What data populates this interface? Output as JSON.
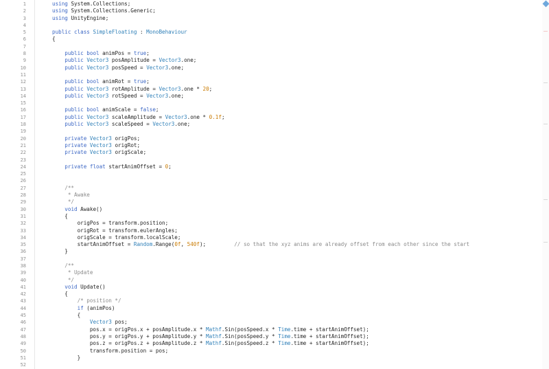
{
  "editor": {
    "lines": [
      {
        "n": "1",
        "t": [
          [
            "kw",
            "using "
          ],
          [
            "pl",
            "System.Collections;"
          ]
        ]
      },
      {
        "n": "2",
        "t": [
          [
            "kw",
            "using "
          ],
          [
            "pl",
            "System.Collections.Generic;"
          ]
        ]
      },
      {
        "n": "3",
        "t": [
          [
            "kw",
            "using "
          ],
          [
            "pl",
            "UnityEngine;"
          ]
        ]
      },
      {
        "n": "4",
        "t": []
      },
      {
        "n": "5",
        "t": [
          [
            "kw",
            "public class "
          ],
          [
            "ty",
            "SimpleFloating"
          ],
          [
            "pl",
            " : "
          ],
          [
            "ty",
            "MonoBehaviour"
          ]
        ]
      },
      {
        "n": "6",
        "t": [
          [
            "pl",
            "{"
          ]
        ]
      },
      {
        "n": "7",
        "t": []
      },
      {
        "n": "8",
        "t": [
          [
            "pl",
            "    "
          ],
          [
            "kw",
            "public bool "
          ],
          [
            "pl",
            "animPos = "
          ],
          [
            "kw",
            "true"
          ],
          [
            "pl",
            ";"
          ]
        ]
      },
      {
        "n": "9",
        "t": [
          [
            "pl",
            "    "
          ],
          [
            "kw",
            "public "
          ],
          [
            "ty",
            "Vector3"
          ],
          [
            "pl",
            " posAmplitude = "
          ],
          [
            "ty",
            "Vector3"
          ],
          [
            "pl",
            ".one;"
          ]
        ]
      },
      {
        "n": "10",
        "t": [
          [
            "pl",
            "    "
          ],
          [
            "kw",
            "public "
          ],
          [
            "ty",
            "Vector3"
          ],
          [
            "pl",
            " posSpeed = "
          ],
          [
            "ty",
            "Vector3"
          ],
          [
            "pl",
            ".one;"
          ]
        ]
      },
      {
        "n": "11",
        "t": []
      },
      {
        "n": "12",
        "t": [
          [
            "pl",
            "    "
          ],
          [
            "kw",
            "public bool "
          ],
          [
            "pl",
            "animRot = "
          ],
          [
            "kw",
            "true"
          ],
          [
            "pl",
            ";"
          ]
        ]
      },
      {
        "n": "13",
        "t": [
          [
            "pl",
            "    "
          ],
          [
            "kw",
            "public "
          ],
          [
            "ty",
            "Vector3"
          ],
          [
            "pl",
            " rotAmplitude = "
          ],
          [
            "ty",
            "Vector3"
          ],
          [
            "pl",
            ".one * "
          ],
          [
            "num",
            "20"
          ],
          [
            "pl",
            ";"
          ]
        ]
      },
      {
        "n": "14",
        "t": [
          [
            "pl",
            "    "
          ],
          [
            "kw",
            "public "
          ],
          [
            "ty",
            "Vector3"
          ],
          [
            "pl",
            " rotSpeed = "
          ],
          [
            "ty",
            "Vector3"
          ],
          [
            "pl",
            ".one;"
          ]
        ]
      },
      {
        "n": "15",
        "t": []
      },
      {
        "n": "16",
        "t": [
          [
            "pl",
            "    "
          ],
          [
            "kw",
            "public bool "
          ],
          [
            "pl",
            "animScale = "
          ],
          [
            "kw",
            "false"
          ],
          [
            "pl",
            ";"
          ]
        ]
      },
      {
        "n": "17",
        "t": [
          [
            "pl",
            "    "
          ],
          [
            "kw",
            "public "
          ],
          [
            "ty",
            "Vector3"
          ],
          [
            "pl",
            " scaleAmplitude = "
          ],
          [
            "ty",
            "Vector3"
          ],
          [
            "pl",
            ".one * "
          ],
          [
            "num",
            "0.1f"
          ],
          [
            "pl",
            ";"
          ]
        ]
      },
      {
        "n": "18",
        "t": [
          [
            "pl",
            "    "
          ],
          [
            "kw",
            "public "
          ],
          [
            "ty",
            "Vector3"
          ],
          [
            "pl",
            " scaleSpeed = "
          ],
          [
            "ty",
            "Vector3"
          ],
          [
            "pl",
            ".one;"
          ]
        ]
      },
      {
        "n": "19",
        "t": []
      },
      {
        "n": "20",
        "t": [
          [
            "pl",
            "    "
          ],
          [
            "kw",
            "private "
          ],
          [
            "ty",
            "Vector3"
          ],
          [
            "pl",
            " origPos;"
          ]
        ]
      },
      {
        "n": "21",
        "t": [
          [
            "pl",
            "    "
          ],
          [
            "kw",
            "private "
          ],
          [
            "ty",
            "Vector3"
          ],
          [
            "pl",
            " origRot;"
          ]
        ]
      },
      {
        "n": "22",
        "t": [
          [
            "pl",
            "    "
          ],
          [
            "kw",
            "private "
          ],
          [
            "ty",
            "Vector3"
          ],
          [
            "pl",
            " origScale;"
          ]
        ]
      },
      {
        "n": "23",
        "t": []
      },
      {
        "n": "24",
        "t": [
          [
            "pl",
            "    "
          ],
          [
            "kw",
            "private float "
          ],
          [
            "pl",
            "startAnimOffset = "
          ],
          [
            "num",
            "0"
          ],
          [
            "pl",
            ";"
          ]
        ]
      },
      {
        "n": "25",
        "t": []
      },
      {
        "n": "26",
        "t": []
      },
      {
        "n": "27",
        "t": [
          [
            "cm",
            "    /**"
          ]
        ]
      },
      {
        "n": "28",
        "t": [
          [
            "cm",
            "     * Awake"
          ]
        ]
      },
      {
        "n": "29",
        "t": [
          [
            "cm",
            "     */"
          ]
        ]
      },
      {
        "n": "30",
        "t": [
          [
            "pl",
            "    "
          ],
          [
            "kw",
            "void "
          ],
          [
            "pl",
            "Awake()"
          ]
        ]
      },
      {
        "n": "31",
        "t": [
          [
            "pl",
            "    {"
          ]
        ]
      },
      {
        "n": "32",
        "t": [
          [
            "pl",
            "        origPos = transform.position;"
          ]
        ]
      },
      {
        "n": "33",
        "t": [
          [
            "pl",
            "        origRot = transform.eulerAngles;"
          ]
        ]
      },
      {
        "n": "34",
        "t": [
          [
            "pl",
            "        origScale = transform.localScale;"
          ]
        ]
      },
      {
        "n": "35",
        "t": [
          [
            "pl",
            "        startAnimOffset = "
          ],
          [
            "ty",
            "Random"
          ],
          [
            "pl",
            ".Range("
          ],
          [
            "num",
            "0f"
          ],
          [
            "pl",
            ", "
          ],
          [
            "num",
            "540f"
          ],
          [
            "pl",
            ");"
          ],
          [
            "cm",
            "         // so that the xyz anims are already offset from each other since the start"
          ]
        ]
      },
      {
        "n": "36",
        "t": [
          [
            "pl",
            "    }"
          ]
        ]
      },
      {
        "n": "37",
        "t": []
      },
      {
        "n": "38",
        "t": [
          [
            "cm",
            "    /**"
          ]
        ]
      },
      {
        "n": "39",
        "t": [
          [
            "cm",
            "     * Update"
          ]
        ]
      },
      {
        "n": "40",
        "t": [
          [
            "cm",
            "     */"
          ]
        ]
      },
      {
        "n": "41",
        "t": [
          [
            "pl",
            "    "
          ],
          [
            "kw",
            "void "
          ],
          [
            "pl",
            "Update()"
          ]
        ]
      },
      {
        "n": "42",
        "t": [
          [
            "pl",
            "    {"
          ]
        ]
      },
      {
        "n": "43",
        "t": [
          [
            "cm",
            "        /* position */"
          ]
        ]
      },
      {
        "n": "44",
        "t": [
          [
            "pl",
            "        "
          ],
          [
            "kw",
            "if "
          ],
          [
            "pl",
            "(animPos)"
          ]
        ]
      },
      {
        "n": "45",
        "t": [
          [
            "pl",
            "        {"
          ]
        ]
      },
      {
        "n": "46",
        "t": [
          [
            "pl",
            "            "
          ],
          [
            "ty",
            "Vector3"
          ],
          [
            "pl",
            " pos;"
          ]
        ]
      },
      {
        "n": "47",
        "t": [
          [
            "pl",
            "            pos.x = origPos.x + posAmplitude.x * "
          ],
          [
            "ty",
            "Mathf"
          ],
          [
            "pl",
            ".Sin(posSpeed.x * "
          ],
          [
            "ty",
            "Time"
          ],
          [
            "pl",
            ".time + startAnimOffset);"
          ]
        ]
      },
      {
        "n": "48",
        "t": [
          [
            "pl",
            "            pos.y = origPos.y + posAmplitude.y * "
          ],
          [
            "ty",
            "Mathf"
          ],
          [
            "pl",
            ".Sin(posSpeed.y * "
          ],
          [
            "ty",
            "Time"
          ],
          [
            "pl",
            ".time + startAnimOffset);"
          ]
        ]
      },
      {
        "n": "49",
        "t": [
          [
            "pl",
            "            pos.z = origPos.z + posAmplitude.z * "
          ],
          [
            "ty",
            "Mathf"
          ],
          [
            "pl",
            ".Sin(posSpeed.z * "
          ],
          [
            "ty",
            "Time"
          ],
          [
            "pl",
            ".time + startAnimOffset);"
          ]
        ]
      },
      {
        "n": "50",
        "t": [
          [
            "pl",
            "            transform.position = pos;"
          ]
        ]
      },
      {
        "n": "51",
        "t": [
          [
            "pl",
            "        }"
          ]
        ]
      },
      {
        "n": "52",
        "t": []
      }
    ]
  },
  "colors": {
    "keyword": "#3b66c4",
    "type": "#2e7fb8",
    "number": "#c97a00",
    "comment": "#8a8a8a",
    "scroll_marker": "#6fa8dc"
  }
}
